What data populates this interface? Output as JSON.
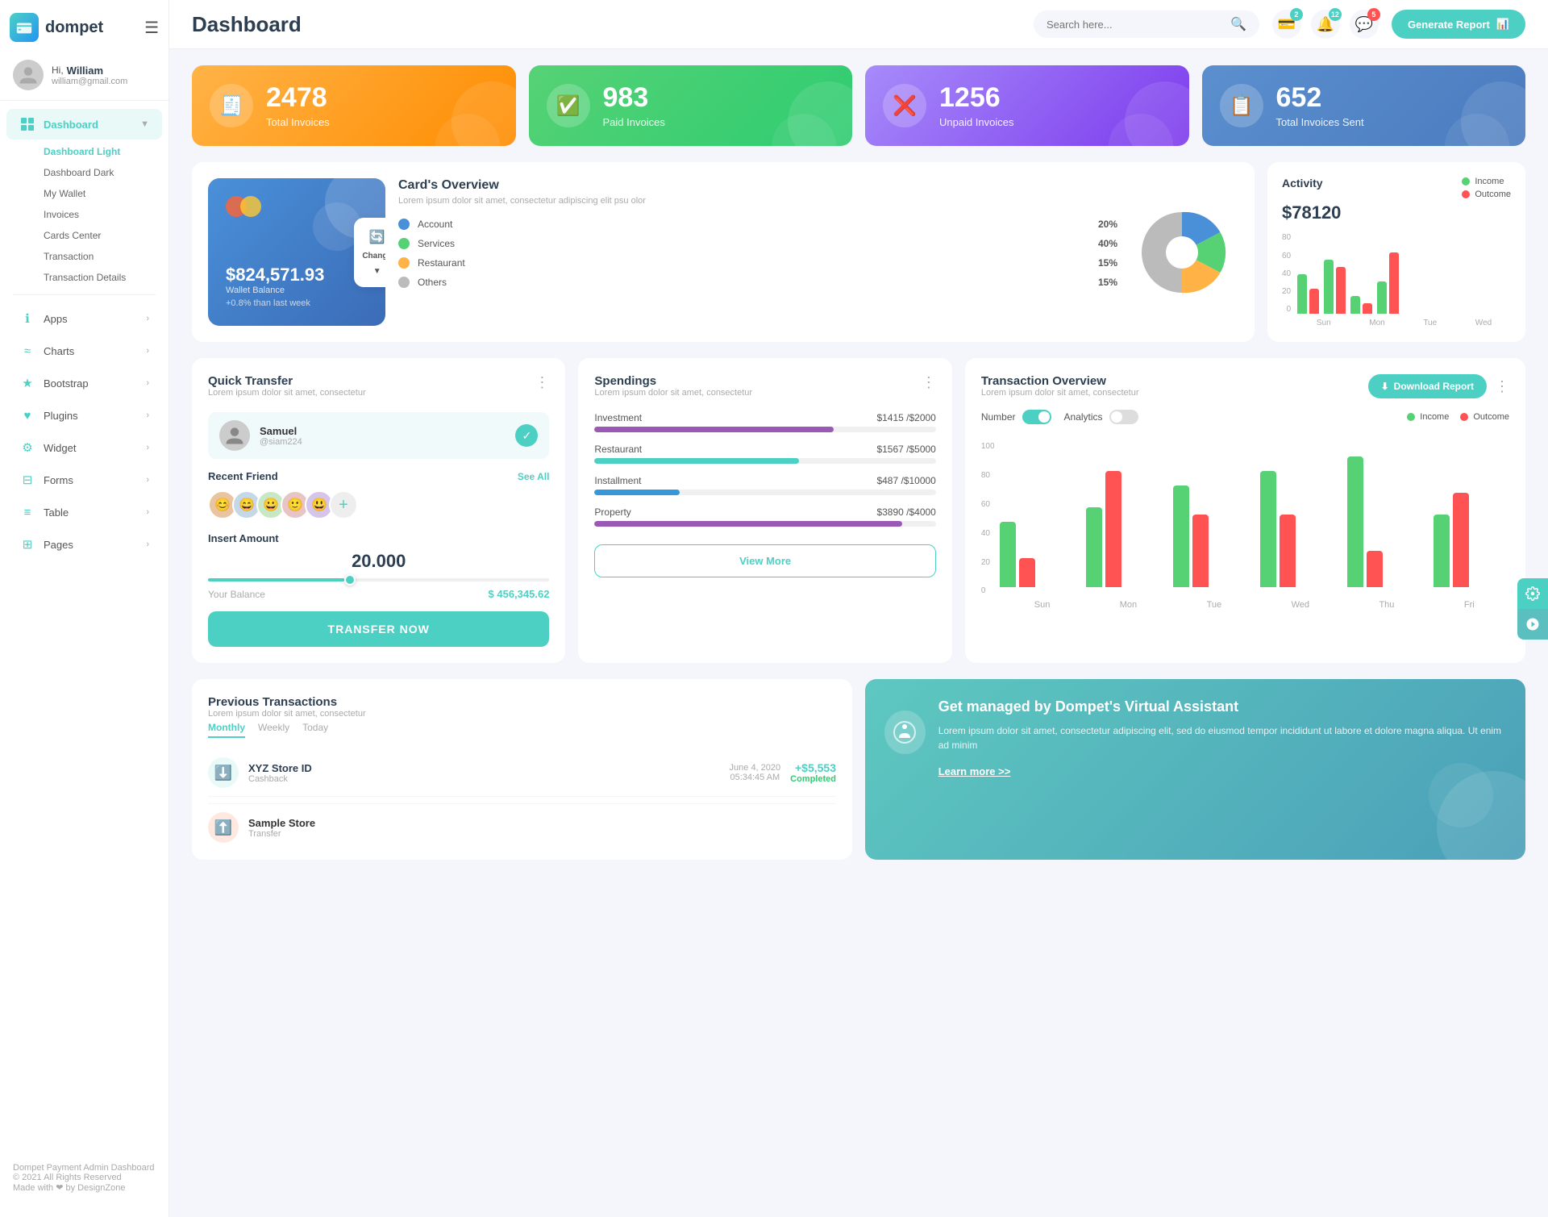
{
  "app": {
    "name": "dompet",
    "logo_emoji": "💳"
  },
  "header": {
    "title": "Dashboard",
    "search_placeholder": "Search here...",
    "generate_btn": "Generate Report",
    "icons": {
      "wallet_badge": "2",
      "bell_badge": "12",
      "chat_badge": "5"
    }
  },
  "user": {
    "greeting": "Hi,",
    "name": "William",
    "email": "william@gmail.com",
    "avatar_emoji": "👤"
  },
  "sidebar": {
    "dashboard_label": "Dashboard",
    "sub_items": [
      "Dashboard Light",
      "Dashboard Dark",
      "My Wallet",
      "Invoices",
      "Cards Center",
      "Transaction",
      "Transaction Details"
    ],
    "menu_items": [
      {
        "label": "Apps",
        "icon": "ℹ️"
      },
      {
        "label": "Charts",
        "icon": "📈"
      },
      {
        "label": "Bootstrap",
        "icon": "⭐"
      },
      {
        "label": "Plugins",
        "icon": "❤️"
      },
      {
        "label": "Widget",
        "icon": "⚙️"
      },
      {
        "label": "Forms",
        "icon": "🖨️"
      },
      {
        "label": "Table",
        "icon": "☰"
      },
      {
        "label": "Pages",
        "icon": "🗒️"
      }
    ],
    "footer": {
      "brand": "Dompet Payment Admin Dashboard",
      "copy": "© 2021 All Rights Reserved",
      "made_with": "Made with ❤ by DesignZone"
    }
  },
  "stats": [
    {
      "number": "2478",
      "label": "Total Invoices",
      "icon": "🧾",
      "color_class": "orange"
    },
    {
      "number": "983",
      "label": "Paid Invoices",
      "icon": "✅",
      "color_class": "green"
    },
    {
      "number": "1256",
      "label": "Unpaid Invoices",
      "icon": "❌",
      "color_class": "purple"
    },
    {
      "number": "652",
      "label": "Total Invoices Sent",
      "icon": "📋",
      "color_class": "blue-gray"
    }
  ],
  "cards_overview": {
    "title": "Card's Overview",
    "subtitle": "Lorem ipsum dolor sit amet, consectetur adipiscing elit psu olor",
    "wallet_amount": "$824,571.93",
    "wallet_label": "Wallet Balance",
    "wallet_change": "+0.8% than last week",
    "change_btn": "Change",
    "items": [
      {
        "label": "Account",
        "pct": "20%",
        "color": "#4a90d9"
      },
      {
        "label": "Services",
        "pct": "40%",
        "color": "#56d275"
      },
      {
        "label": "Restaurant",
        "pct": "15%",
        "color": "#ffb347"
      },
      {
        "label": "Others",
        "pct": "15%",
        "color": "#bbb"
      }
    ]
  },
  "activity": {
    "title": "Activity",
    "amount": "$78120",
    "income_label": "Income",
    "outcome_label": "Outcome",
    "chart_labels": [
      "Sun",
      "Mon",
      "Tue",
      "Wed"
    ],
    "y_labels": [
      "80",
      "60",
      "40",
      "20",
      "0"
    ],
    "bars": [
      {
        "income": 55,
        "outcome": 35
      },
      {
        "income": 75,
        "outcome": 65
      },
      {
        "income": 25,
        "outcome": 15
      },
      {
        "income": 45,
        "outcome": 85
      }
    ]
  },
  "quick_transfer": {
    "title": "Quick Transfer",
    "subtitle": "Lorem ipsum dolor sit amet, consectetur",
    "contact_name": "Samuel",
    "contact_handle": "@siam224",
    "recent_label": "Recent Friend",
    "see_more": "See All",
    "amount_label": "Insert Amount",
    "amount_value": "20.000",
    "balance_label": "Your Balance",
    "balance_value": "$ 456,345.62",
    "transfer_btn": "TRANSFER NOW"
  },
  "spendings": {
    "title": "Spendings",
    "subtitle": "Lorem ipsum dolor sit amet, consectetur",
    "items": [
      {
        "label": "Investment",
        "amount": "$1415",
        "max": "$2000",
        "pct": 70,
        "color": "#9b59b6"
      },
      {
        "label": "Restaurant",
        "amount": "$1567",
        "max": "$5000",
        "pct": 60,
        "color": "#4dd0c4"
      },
      {
        "label": "Installment",
        "amount": "$487",
        "max": "$10000",
        "pct": 25,
        "color": "#3498db"
      },
      {
        "label": "Property",
        "amount": "$3890",
        "max": "$4000",
        "pct": 90,
        "color": "#9b59b6"
      }
    ],
    "view_more": "View More"
  },
  "transaction_overview": {
    "title": "Transaction Overview",
    "subtitle": "Lorem ipsum dolor sit amet, consectetur",
    "download_btn": "Download Report",
    "number_label": "Number",
    "analytics_label": "Analytics",
    "income_label": "Income",
    "outcome_label": "Outcome",
    "x_labels": [
      "Sun",
      "Mon",
      "Tue",
      "Wed",
      "Thu",
      "Fri"
    ],
    "y_labels": [
      "100",
      "80",
      "60",
      "40",
      "20",
      "0"
    ],
    "bars": [
      {
        "inc": 45,
        "out": 20
      },
      {
        "inc": 55,
        "out": 80
      },
      {
        "inc": 70,
        "out": 50
      },
      {
        "inc": 80,
        "out": 50
      },
      {
        "inc": 90,
        "out": 25
      },
      {
        "inc": 50,
        "out": 65
      }
    ]
  },
  "previous_transactions": {
    "title": "Previous Transactions",
    "subtitle": "Lorem ipsum dolor sit amet, consectetur",
    "tabs": [
      "Monthly",
      "Weekly",
      "Today"
    ],
    "active_tab": "Monthly",
    "rows": [
      {
        "name": "XYZ Store ID",
        "type": "Cashback",
        "date": "June 4, 2020",
        "time": "05:34:45 AM",
        "amount": "+$5,553",
        "status": "Completed",
        "icon": "⬇️"
      }
    ]
  },
  "virtual_assistant": {
    "title": "Get managed by Dompet's Virtual Assistant",
    "subtitle": "Lorem ipsum dolor sit amet, consectetur adipiscing elit, sed do eiusmod tempor incididunt ut labore et dolore magna aliqua. Ut enim ad minim",
    "link": "Learn more >>"
  }
}
